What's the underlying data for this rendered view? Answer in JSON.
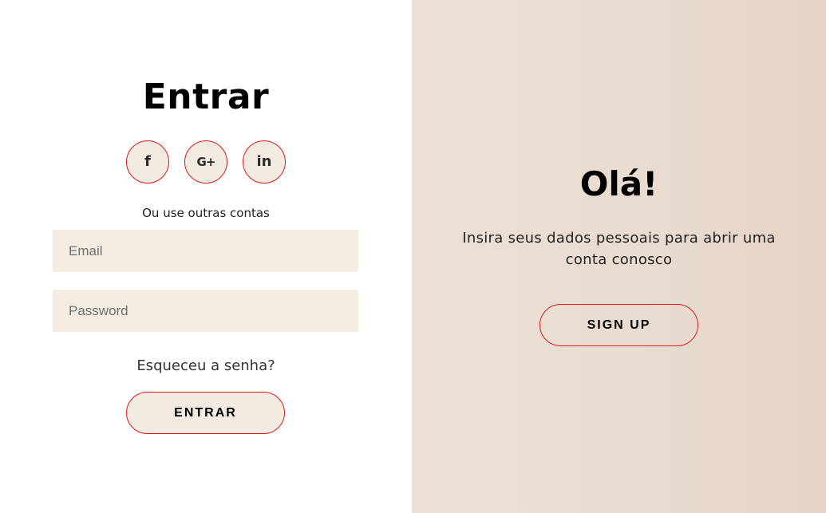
{
  "login": {
    "title": "Entrar",
    "socials": [
      {
        "label": "f",
        "icon": "facebook-icon"
      },
      {
        "label": "G+",
        "icon": "google-plus-icon"
      },
      {
        "label": "in",
        "icon": "linkedin-icon"
      }
    ],
    "alt_text": "Ou use outras contas",
    "email_placeholder": "Email",
    "email_value": "",
    "password_placeholder": "Password",
    "password_value": "",
    "forgot_label": "Esqueceu a senha?",
    "submit_label": "ENTRAR"
  },
  "signup_panel": {
    "title": "Olá!",
    "description": "Insira seus dados pessoais para abrir uma conta conosco",
    "button_label": "SIGN UP"
  },
  "colors": {
    "accent_border": "#e01818",
    "input_bg": "#f2ece2",
    "panel_bg": "#ebdfd3"
  }
}
